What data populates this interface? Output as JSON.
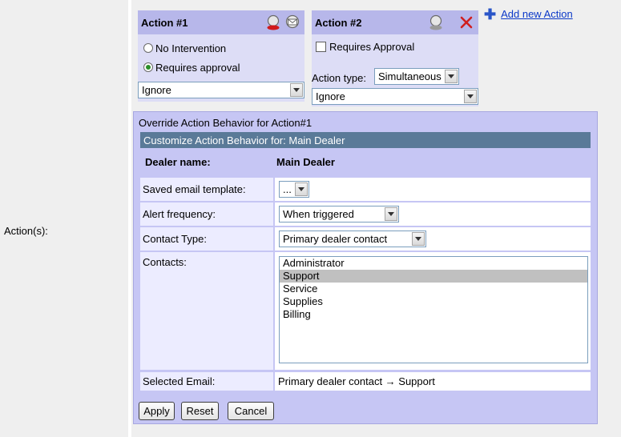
{
  "row_label": "Action(s):",
  "add_action_label": "Add new Action",
  "action1": {
    "title": "Action #1",
    "radio_no_intervention": "No Intervention",
    "radio_requires_approval": "Requires approval",
    "selected_radio": "requires_approval",
    "behavior_value": "Ignore"
  },
  "action2": {
    "title": "Action #2",
    "requires_approval_label": "Requires Approval",
    "requires_approval_checked": false,
    "action_type_label": "Action type:",
    "action_type_value": "Simultaneous",
    "behavior_value": "Ignore"
  },
  "override": {
    "title": "Override Action Behavior for Action#1",
    "customize_header": "Customize Action Behavior for: Main Dealer",
    "dealer_label": "Dealer name:",
    "dealer_value": "Main Dealer",
    "email_template_label": "Saved email template:",
    "email_template_value": "...",
    "alert_frequency_label": "Alert frequency:",
    "alert_frequency_value": "When triggered",
    "contact_type_label": "Contact Type:",
    "contact_type_value": "Primary dealer contact",
    "contacts_label": "Contacts:",
    "contacts": [
      "Administrator",
      "Support",
      "Service",
      "Supplies",
      "Billing"
    ],
    "selected_contact": "Support",
    "selected_email_label": "Selected Email:",
    "selected_email_value": "Primary dealer contact → Support"
  },
  "buttons": {
    "apply": "Apply",
    "reset": "Reset",
    "cancel": "Cancel"
  },
  "colors": {
    "header_bg": "#b7b7ea",
    "panel_bg": "#c6c6f4",
    "customize_bar": "#5a7a98",
    "delete_icon": "#d01f1f",
    "link": "#0b38c8"
  }
}
